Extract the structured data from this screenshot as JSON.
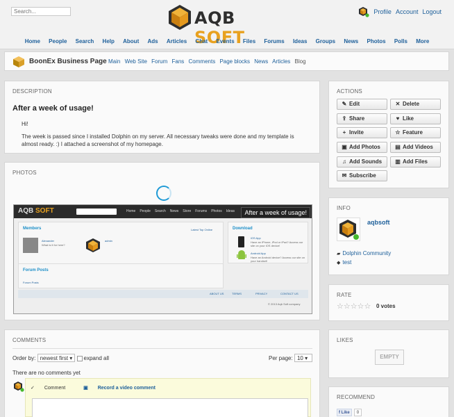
{
  "header": {
    "search_placeholder": "Search...",
    "logo": {
      "part1": "AQB",
      "part2": "SOFT"
    },
    "user_links": [
      "Profile",
      "Account",
      "Logout"
    ],
    "nav": [
      "Home",
      "People",
      "Search",
      "Help",
      "About",
      "Ads",
      "Articles",
      "Chat",
      "Events",
      "Files",
      "Forums",
      "Ideas",
      "Groups",
      "News",
      "Photos",
      "Polls",
      "More"
    ]
  },
  "subbar": {
    "title": "BoonEx Business Page",
    "links": [
      "Main",
      "Web Site",
      "Forum",
      "Fans",
      "Comments",
      "Page blocks",
      "News",
      "Articles",
      "Blog"
    ]
  },
  "description": {
    "box_title": "DESCRIPTION",
    "heading": "After a week of usage!",
    "greeting": "Hi!",
    "body": "The week is passed since I installed Dolphin on my server. All necessary tweaks were done and my template is almost ready. :) I attached a screenshot of my homepage."
  },
  "photos": {
    "box_title": "PHOTOS",
    "screenshot": {
      "logo": {
        "part1": "AQB",
        "part2": "SOFT"
      },
      "nav": [
        "Home",
        "People",
        "Search",
        "News",
        "Store",
        "Forums",
        "Photos",
        "Ideas"
      ],
      "banner": "After a week of usage!",
      "members_title": "Members",
      "members_tabs": [
        "Latest",
        "Top",
        "Online"
      ],
      "member1_name": "Alexander",
      "member1_text": "What is it for here?",
      "member2_name": "admin",
      "download_title": "Download",
      "ios_title": "iOS App",
      "ios_text": "Have an iPhone, iPod or iPad? Access our site on your iOS device!",
      "android_title": "Android App",
      "android_text": "Have an Android device? Access our site on your handset!",
      "forum_title": "Forum Posts",
      "forum_link": "Forum Posts",
      "footer_links": [
        "ABOUT US",
        "TERMS",
        "PRIVACY",
        "CONTACT US"
      ],
      "copyright": "© 2013 Aqb Soft company"
    }
  },
  "comments": {
    "box_title": "COMMENTS",
    "order_label": "Order by:",
    "order_value": "newest first",
    "expand_label": "expand all",
    "per_page_label": "Per page:",
    "per_page_value": "10",
    "empty_text": "There are no comments yet",
    "tab_comment": "Comment",
    "tab_video": "Record a video comment"
  },
  "actions": {
    "box_title": "ACTIONS",
    "buttons": [
      {
        "label": "Edit",
        "icon": "✎"
      },
      {
        "label": "Delete",
        "icon": "✕"
      },
      {
        "label": "Share",
        "icon": "⇪"
      },
      {
        "label": "Like",
        "icon": "♥"
      },
      {
        "label": "Invite",
        "icon": "+"
      },
      {
        "label": "Feature",
        "icon": "☆"
      },
      {
        "label": "Add Photos",
        "icon": "▣"
      },
      {
        "label": "Add Videos",
        "icon": "▤"
      },
      {
        "label": "Add Sounds",
        "icon": "♫"
      },
      {
        "label": "Add Files",
        "icon": "▥"
      },
      {
        "label": "Subscribe",
        "icon": "✉"
      }
    ]
  },
  "info": {
    "box_title": "INFO",
    "author": "aqbsoft",
    "category": "Dolphin Community",
    "tag": "test"
  },
  "rate": {
    "box_title": "RATE",
    "stars_filled": 0,
    "votes": "0 votes"
  },
  "likes": {
    "box_title": "LIKES",
    "empty": "EMPTY"
  },
  "recommend": {
    "box_title": "RECOMMEND",
    "fb_like": "Like",
    "fb_count": "0"
  },
  "colors": {
    "link": "#1d5f9a",
    "accent_orange": "#e8a11f",
    "logo_dark": "#2e2e2e",
    "online_green": "#46b82e",
    "spinner": "#1e9ad6"
  }
}
